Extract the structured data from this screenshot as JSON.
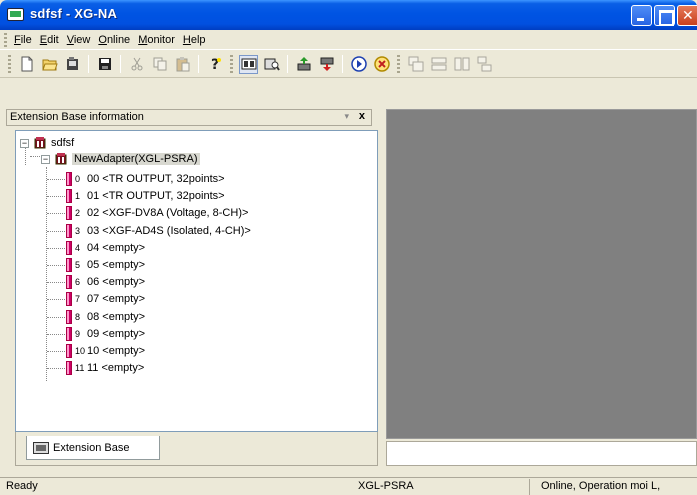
{
  "window": {
    "title": "sdfsf - XG-NA"
  },
  "menu": [
    {
      "label": "File",
      "underline": "F",
      "rest": "ile"
    },
    {
      "label": "Edit",
      "underline": "E",
      "rest": "dit"
    },
    {
      "label": "View",
      "underline": "V",
      "rest": "iew"
    },
    {
      "label": "Online",
      "underline": "O",
      "rest": "nline"
    },
    {
      "label": "Monitor",
      "underline": "M",
      "rest": "onitor"
    },
    {
      "label": "Help",
      "underline": "H",
      "rest": "elp"
    }
  ],
  "panel": {
    "title": "Extension Base information",
    "pin_glyph": "▾",
    "close_glyph": "x",
    "tab_label": "Extension Base"
  },
  "tree": {
    "root": "sdfsf",
    "adapter": "NewAdapter(XGL-PSRA)",
    "slots": [
      {
        "num": "0",
        "label": "00 <TR OUTPUT, 32points>"
      },
      {
        "num": "1",
        "label": "01 <TR OUTPUT, 32points>"
      },
      {
        "num": "2",
        "label": "02 <XGF-DV8A (Voltage, 8-CH)>"
      },
      {
        "num": "3",
        "label": "03 <XGF-AD4S (Isolated, 4-CH)>"
      },
      {
        "num": "4",
        "label": "04 <empty>"
      },
      {
        "num": "5",
        "label": "05 <empty>"
      },
      {
        "num": "6",
        "label": "06 <empty>"
      },
      {
        "num": "7",
        "label": "07 <empty>"
      },
      {
        "num": "8",
        "label": "08 <empty>"
      },
      {
        "num": "9",
        "label": "09 <empty>"
      },
      {
        "num": "10",
        "label": "10 <empty>"
      },
      {
        "num": "11",
        "label": "11 <empty>"
      }
    ]
  },
  "status": {
    "left": "Ready",
    "center": "XGL-PSRA",
    "right": "Online, Operation moi L,"
  },
  "colors": {
    "titlebar": "#0054e3",
    "workspace": "#808080",
    "selection": "#d8d8d0"
  }
}
